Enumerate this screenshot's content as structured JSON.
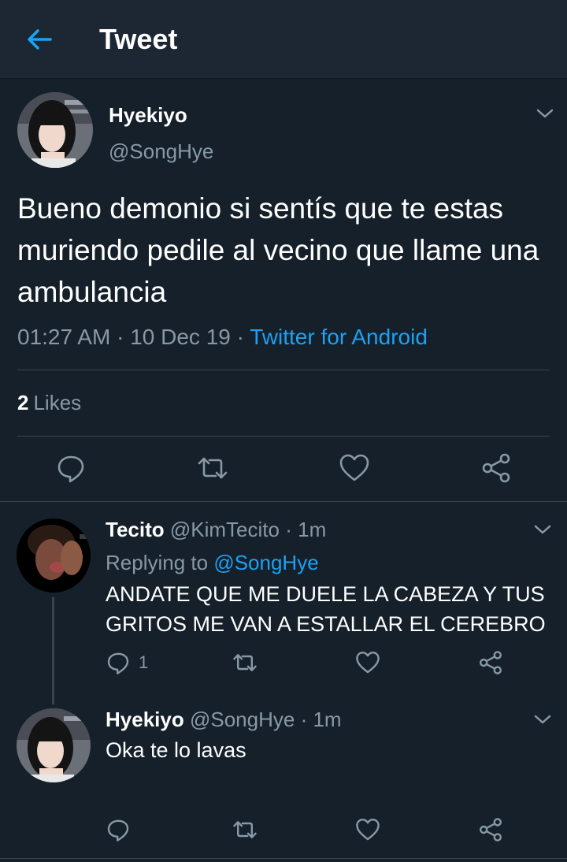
{
  "header": {
    "title": "Tweet",
    "accent_color": "#1da1f2",
    "back_icon": "arrow-left-icon"
  },
  "main_tweet": {
    "author_name": "Hyekiyo",
    "author_handle": "@SongHye",
    "text": "Bueno demonio si sentís que te estas muriendo pedile al vecino que llame una ambulancia",
    "time": "01:27 AM",
    "date": "10 Dec 19",
    "source": "Twitter for Android",
    "likes_count": "2",
    "likes_label": "Likes",
    "menu_icon": "chevron-down-icon",
    "actions": [
      "reply-icon",
      "retweet-icon",
      "like-icon",
      "share-icon"
    ]
  },
  "replies": [
    {
      "author_name": "Tecito",
      "author_handle": "@KimTecito",
      "age": "1m",
      "replying_to_label": "Replying to",
      "replying_to_handle": "@SongHye",
      "text": "ANDATE QUE ME DUELE LA CABEZA Y TUS GRITOS ME VAN A ESTALLAR EL CEREBRO",
      "reply_count": "1"
    },
    {
      "author_name": "Hyekiyo",
      "author_handle": "@SongHye",
      "age": "1m",
      "text": "Oka te lo lavas"
    }
  ],
  "separator": "·",
  "colors": {
    "background": "#15202b",
    "header_bg": "#1c2733",
    "secondary_text": "#8899a6",
    "divider": "#38444d",
    "link": "#1da1f2"
  }
}
